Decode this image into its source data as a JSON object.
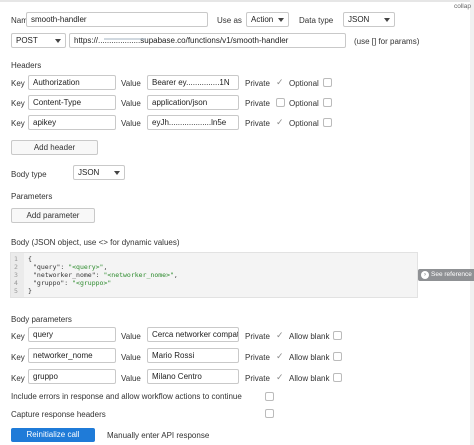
{
  "collapse_label": "collap",
  "name_label": "Name",
  "name_value": "smooth-handler",
  "use_as_label": "Use as",
  "use_as_value": "Action",
  "data_type_label": "Data type",
  "data_type_value": "JSON",
  "method_value": "POST",
  "url_value": "https://...................supabase.co/functions/v1/smooth-handler",
  "url_hint": "(use [] for params)",
  "headers_label": "Headers",
  "key_label": "Key",
  "value_label": "Value",
  "private_label": "Private",
  "optional_label": "Optional",
  "allow_blank_label": "Allow blank",
  "headers": [
    {
      "key": "Authorization",
      "value": "Bearer ey...............1N"
    },
    {
      "key": "Content-Type",
      "value": "application/json"
    },
    {
      "key": "apikey",
      "value": "eyJh...................ln5e"
    }
  ],
  "add_header_label": "Add header",
  "body_type_label": "Body type",
  "body_type_value": "JSON",
  "parameters_label": "Parameters",
  "add_parameter_label": "Add parameter",
  "body_label": "Body (JSON object, use <> for dynamic values)",
  "code_lines": [
    "1",
    "2",
    "3",
    "4",
    "5"
  ],
  "code": {
    "l1": "{",
    "l2_key": "\"query\": ",
    "l2_val": "\"<query>\"",
    "l2_end": ",",
    "l3_key": "\"networker_nome\": ",
    "l3_val": "\"<networker_nome>\"",
    "l3_end": ",",
    "l4_key": "\"gruppo\": ",
    "l4_val": "\"<gruppo>\"",
    "l5": "}"
  },
  "see_reference_label": "See reference",
  "body_parameters_label": "Body parameters",
  "body_params": [
    {
      "key": "query",
      "value": "Cerca networker compati"
    },
    {
      "key": "networker_nome",
      "value": "Mario Rossi"
    },
    {
      "key": "gruppo",
      "value": "Milano Centro"
    }
  ],
  "include_errors_label": "Include errors in response and allow workflow actions to continue",
  "capture_headers_label": "Capture response headers",
  "reinitialize_label": "Reinitialize call",
  "manual_api_label": "Manually enter API response"
}
